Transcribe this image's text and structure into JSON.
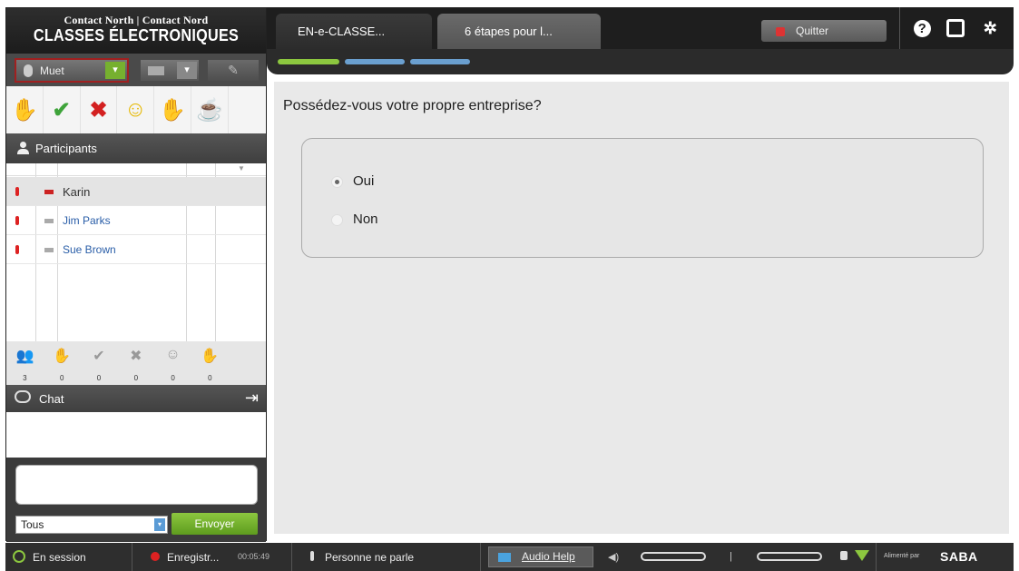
{
  "brand": {
    "top": "Contact North | Contact Nord",
    "main": "CLASSES ÉLECTRONIQUES"
  },
  "media": {
    "mic_label": "Muet",
    "mic_dropdown": "▾",
    "cam_dropdown": "▾",
    "pen_icon": "✎"
  },
  "emotes": [
    {
      "icon": "raise-hand-icon",
      "glyph": "✋"
    },
    {
      "icon": "check-icon",
      "glyph": "✔"
    },
    {
      "icon": "cross-icon",
      "glyph": "✖"
    },
    {
      "icon": "smile-icon",
      "glyph": "☺"
    },
    {
      "icon": "applause-icon",
      "glyph": "✋"
    },
    {
      "icon": "away-icon",
      "glyph": "☕"
    }
  ],
  "participants": {
    "title": "Participants",
    "sort_icon": "▼",
    "list": [
      {
        "name": "Karin",
        "selected": true
      },
      {
        "name": "Jim Parks",
        "selected": false
      },
      {
        "name": "Sue Brown",
        "selected": false
      }
    ],
    "counts": [
      {
        "icon": "participants-count-icon",
        "glyph": "👥",
        "value": "3"
      },
      {
        "icon": "raise-hand-count-icon",
        "glyph": "✋",
        "value": "0"
      },
      {
        "icon": "check-count-icon",
        "glyph": "✔",
        "value": "0"
      },
      {
        "icon": "cross-count-icon",
        "glyph": "✖",
        "value": "0"
      },
      {
        "icon": "smile-count-icon",
        "glyph": "☺",
        "value": "0"
      },
      {
        "icon": "applause-count-icon",
        "glyph": "✋",
        "value": "0"
      }
    ]
  },
  "chat": {
    "title": "Chat",
    "popout_glyph": "⇥",
    "audience": "Tous",
    "audience_dd": "▾",
    "send_label": "Envoyer"
  },
  "tabs": [
    {
      "label": "EN-e-CLASSE..."
    },
    {
      "label": "6 étapes pour l..."
    }
  ],
  "quit_label": "Quitter",
  "top_icons": {
    "help": "?",
    "settings": "✲"
  },
  "progress": {
    "steps": 3,
    "current_step": 1
  },
  "content": {
    "question": "Possédez-vous votre propre entreprise?",
    "options": [
      {
        "label": "Oui",
        "checked": true
      },
      {
        "label": "Non",
        "checked": false
      }
    ]
  },
  "status": {
    "session": "En session",
    "recording": "Enregistr...",
    "recording_time": "00:05:49",
    "talking": "Personne ne parle",
    "audio_help": "Audio Help",
    "powered_by": "Alimenté par",
    "vendor": "SABA"
  },
  "colors": {
    "accent_green": "#8cc73f",
    "progress_blue": "#6a9fcf",
    "danger_red": "#d32020",
    "dark_bg": "#1e1e1e"
  }
}
